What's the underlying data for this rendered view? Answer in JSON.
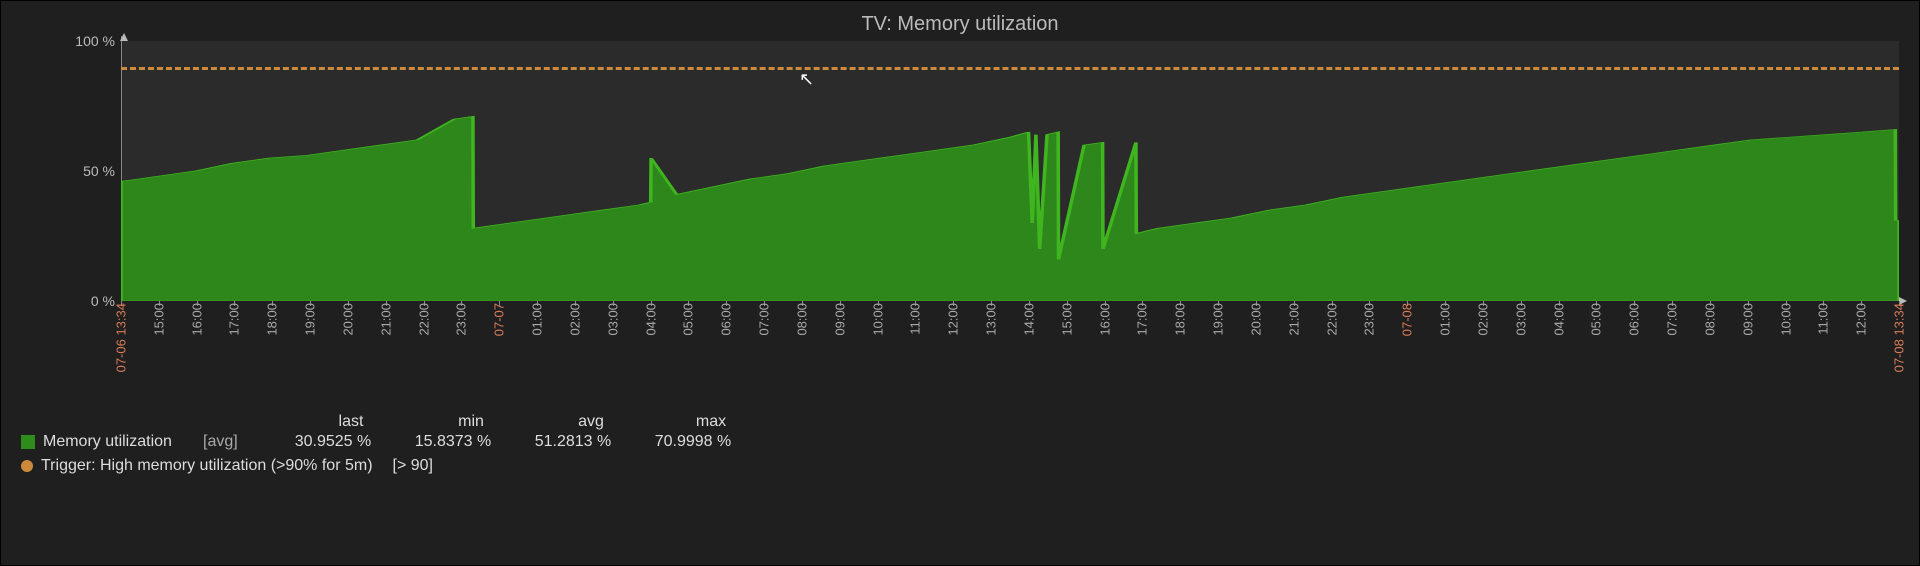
{
  "title": "TV: Memory utilization",
  "y": {
    "ticks": [
      {
        "value": 0,
        "label": "0 %"
      },
      {
        "value": 50,
        "label": "50 %"
      },
      {
        "value": 100,
        "label": "100 %"
      }
    ],
    "min": 0,
    "max": 100
  },
  "x": {
    "labels": [
      {
        "t": "07-06 13:34",
        "boundary": true
      },
      {
        "t": "15:00"
      },
      {
        "t": "16:00"
      },
      {
        "t": "17:00"
      },
      {
        "t": "18:00"
      },
      {
        "t": "19:00"
      },
      {
        "t": "20:00"
      },
      {
        "t": "21:00"
      },
      {
        "t": "22:00"
      },
      {
        "t": "23:00"
      },
      {
        "t": "07-07",
        "boundary": true
      },
      {
        "t": "01:00"
      },
      {
        "t": "02:00"
      },
      {
        "t": "03:00"
      },
      {
        "t": "04:00"
      },
      {
        "t": "05:00"
      },
      {
        "t": "06:00"
      },
      {
        "t": "07:00"
      },
      {
        "t": "08:00"
      },
      {
        "t": "09:00"
      },
      {
        "t": "10:00"
      },
      {
        "t": "11:00"
      },
      {
        "t": "12:00"
      },
      {
        "t": "13:00"
      },
      {
        "t": "14:00"
      },
      {
        "t": "15:00"
      },
      {
        "t": "16:00"
      },
      {
        "t": "17:00"
      },
      {
        "t": "18:00"
      },
      {
        "t": "19:00"
      },
      {
        "t": "20:00"
      },
      {
        "t": "21:00"
      },
      {
        "t": "22:00"
      },
      {
        "t": "23:00"
      },
      {
        "t": "07-08",
        "boundary": true
      },
      {
        "t": "01:00"
      },
      {
        "t": "02:00"
      },
      {
        "t": "03:00"
      },
      {
        "t": "04:00"
      },
      {
        "t": "05:00"
      },
      {
        "t": "06:00"
      },
      {
        "t": "07:00"
      },
      {
        "t": "08:00"
      },
      {
        "t": "09:00"
      },
      {
        "t": "10:00"
      },
      {
        "t": "11:00"
      },
      {
        "t": "12:00"
      },
      {
        "t": "07-08 13:34",
        "boundary": true
      }
    ]
  },
  "series": {
    "name": "Memory utilization",
    "func": "[avg]",
    "color": "#2e8c1a",
    "stats_headers": [
      "last",
      "min",
      "avg",
      "max"
    ],
    "stats": {
      "last": "30.9525 %",
      "min": "15.8373 %",
      "avg": "51.2813 %",
      "max": "70.9998 %"
    }
  },
  "trigger": {
    "label": "Trigger: High memory utilization (>90% for 5m)",
    "cond": "[> 90]",
    "value": 90,
    "color": "#cc8a3c"
  },
  "chart_data": {
    "type": "area",
    "title": "TV: Memory utilization",
    "xlabel": "",
    "ylabel": "%",
    "ylim": [
      0,
      100
    ],
    "trigger_threshold": 90,
    "series": [
      {
        "name": "Memory utilization",
        "color": "#2e8c1a",
        "x_hours_from_start": [
          0,
          1,
          2,
          3,
          4,
          5,
          6,
          7,
          8,
          9,
          9.5,
          9.51,
          10,
          11,
          12,
          13,
          14,
          14.3,
          14.31,
          15,
          16,
          17,
          18,
          19,
          20,
          21,
          22,
          23,
          24,
          24.5,
          24.6,
          24.7,
          24.8,
          25,
          25.3,
          25.31,
          26,
          26.5,
          26.51,
          27.4,
          27.41,
          28,
          29,
          30,
          31,
          32,
          33,
          34,
          35,
          36,
          37,
          38,
          39,
          40,
          41,
          42,
          43,
          44,
          45,
          46,
          47,
          47.9,
          47.91,
          48
        ],
        "y_percent": [
          46,
          48,
          50,
          53,
          55,
          56,
          58,
          60,
          62,
          70,
          71,
          28,
          29,
          31,
          33,
          35,
          37,
          38,
          55,
          41,
          44,
          47,
          49,
          52,
          54,
          56,
          58,
          60,
          63,
          65,
          30,
          64,
          20,
          64,
          65,
          16,
          60,
          61,
          20,
          61,
          26,
          28,
          30,
          32,
          35,
          37,
          40,
          42,
          44,
          46,
          48,
          50,
          52,
          54,
          56,
          58,
          60,
          62,
          63,
          64,
          65,
          66,
          31,
          31
        ]
      }
    ]
  }
}
